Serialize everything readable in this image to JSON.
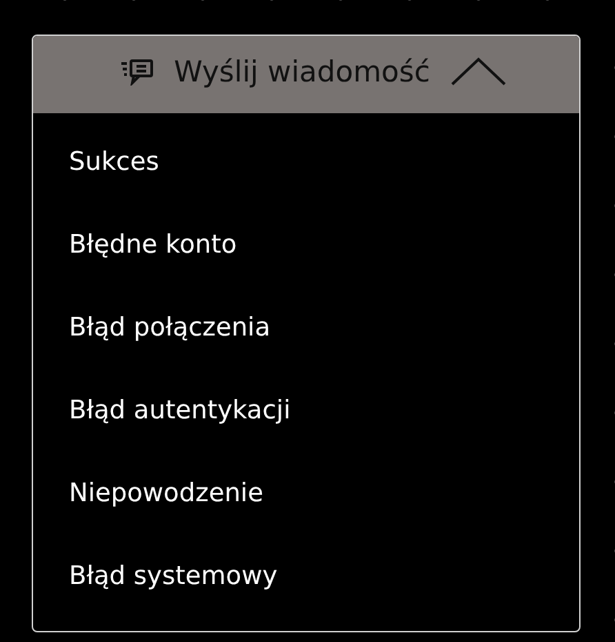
{
  "dropdown": {
    "label": "Wyślij wiadomość",
    "expanded": true,
    "items": [
      {
        "label": "Sukces"
      },
      {
        "label": "Błędne konto"
      },
      {
        "label": "Błąd połączenia"
      },
      {
        "label": "Błąd autentykacji"
      },
      {
        "label": "Niepowodzenie"
      },
      {
        "label": "Błąd systemowy"
      }
    ]
  }
}
